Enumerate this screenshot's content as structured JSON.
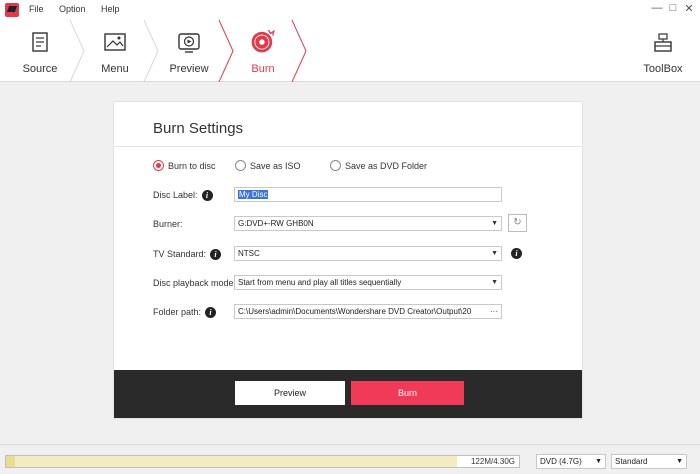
{
  "menu": {
    "file": "File",
    "option": "Option",
    "help": "Help"
  },
  "window_controls": {
    "minimize": "—",
    "maximize": "□",
    "close": "✕"
  },
  "steps": [
    {
      "label": "Source",
      "icon": "document-icon",
      "active": false
    },
    {
      "label": "Menu",
      "icon": "menu-picture-icon",
      "active": false
    },
    {
      "label": "Preview",
      "icon": "preview-play-icon",
      "active": false
    },
    {
      "label": "Burn",
      "icon": "disc-burn-icon",
      "active": true
    }
  ],
  "toolbox": {
    "label": "ToolBox",
    "icon": "toolbox-icon"
  },
  "burn_settings": {
    "title": "Burn Settings",
    "options": {
      "burn_to_disc": "Burn to disc",
      "save_as_iso": "Save as ISO",
      "save_as_dvd_folder": "Save as DVD Folder",
      "selected": "burn_to_disc"
    },
    "disc_label": {
      "label": "Disc Label:",
      "value": "My Disc"
    },
    "burner": {
      "label": "Burner:",
      "value": "G:DVD+-RW GHB0N"
    },
    "tv_standard": {
      "label": "TV Standard:",
      "value": "NTSC"
    },
    "playback_mode": {
      "label": "Disc playback mode:",
      "value": "Start from menu and play all titles sequentially"
    },
    "folder_path": {
      "label": "Folder path:",
      "value": "C:\\Users\\admin\\Documents\\Wondershare DVD Creator\\Output\\20",
      "browse": "···"
    }
  },
  "footer": {
    "preview": "Preview",
    "burn": "Burn"
  },
  "status": {
    "capacity_text": "122M/4.30G",
    "capacity_fraction": 0.028,
    "disc_type": "DVD (4.7G)",
    "quality": "Standard"
  },
  "colors": {
    "accent": "#e23a4d",
    "burn_button": "#f03a58",
    "footer_bg": "#2a2a2a",
    "selection": "#3a74d8"
  }
}
